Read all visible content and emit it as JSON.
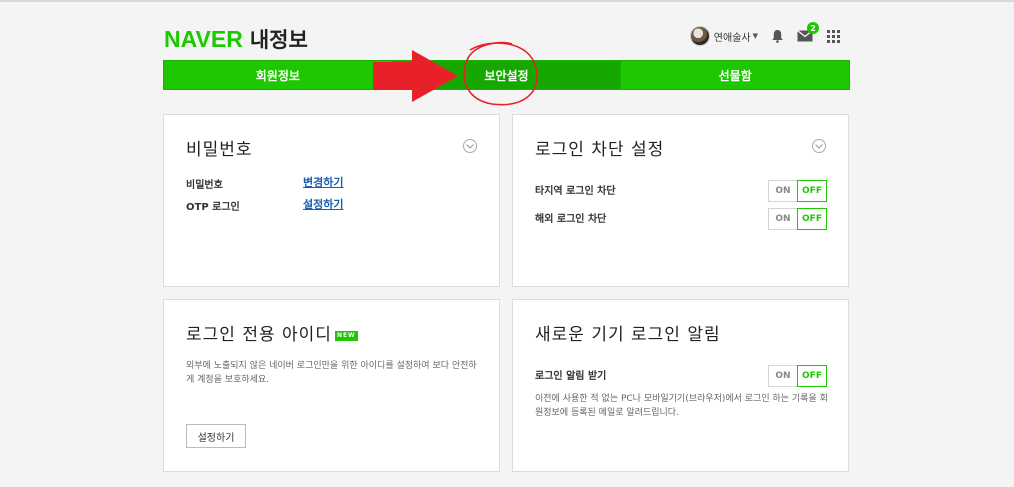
{
  "header": {
    "logo_brand": "NAVER",
    "logo_title": "내정보",
    "username": "연애술사",
    "mail_count": "2"
  },
  "tabs": [
    {
      "label": "회원정보",
      "active": false
    },
    {
      "label": "보안설정",
      "active": true
    },
    {
      "label": "선물함",
      "active": false
    }
  ],
  "password_card": {
    "title": "비밀번호",
    "rows": [
      {
        "label": "비밀번호",
        "link": "변경하기"
      },
      {
        "label": "OTP 로그인",
        "link": "설정하기"
      }
    ]
  },
  "login_block_card": {
    "title": "로그인 차단 설정",
    "rows": [
      {
        "label": "타지역 로그인 차단",
        "on": "ON",
        "off": "OFF"
      },
      {
        "label": "해외 로그인 차단",
        "on": "ON",
        "off": "OFF"
      }
    ]
  },
  "login_only_id_card": {
    "title": "로그인 전용 아이디",
    "badge": "NEW",
    "desc_line1": "외부에 노출되지 않은 네이버 로그인만을 위한 아이디를 설정하여 보다 안전하",
    "desc_line2": "게 계정을 보호하세요.",
    "button": "설정하기"
  },
  "new_device_card": {
    "title": "새로운 기기 로그인 알림",
    "row_label": "로그인 알림 받기",
    "on": "ON",
    "off": "OFF",
    "desc_line1": "이전에 사용한 적 없는 PC나 모바일기기(브라우저)에서 로그인 하는 기록을 회",
    "desc_line2": "원정보에 등록된 메일로 알려드립니다."
  },
  "colors": {
    "brand_green": "#1ec800",
    "active_tab_green": "#16a800",
    "annotation_red": "#e8202a",
    "link_blue": "#1a5fb4"
  }
}
